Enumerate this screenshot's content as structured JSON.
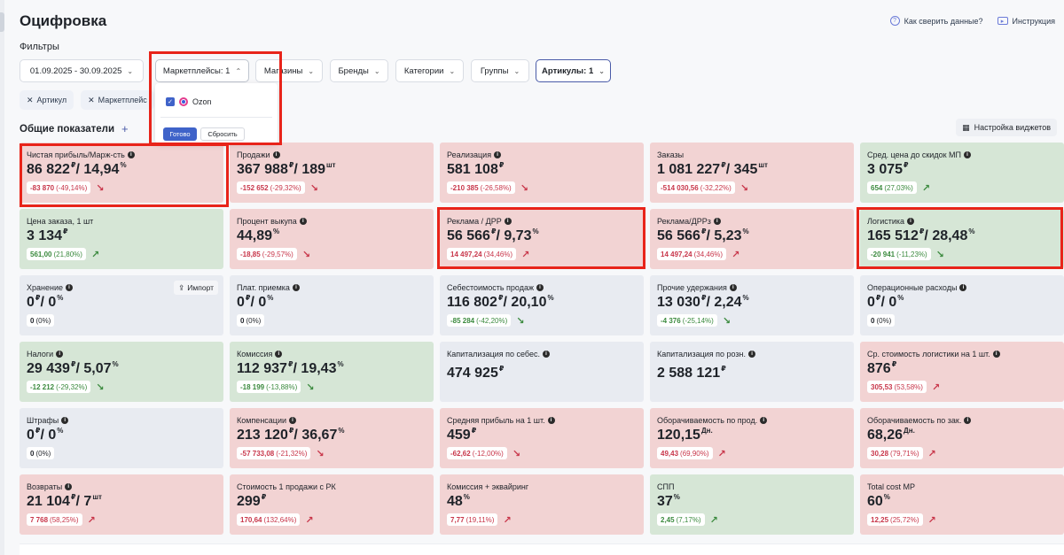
{
  "header": {
    "title": "Оцифровка",
    "link_compare": "Как сверить данные?",
    "link_instructions": "Инструкция"
  },
  "filters": {
    "label": "Фильтры",
    "date_range": "01.09.2025 - 30.09.2025",
    "marketplaces": "Маркетплейсы: 1",
    "stores": "Магазины",
    "brands": "Бренды",
    "categories": "Категории",
    "groups": "Группы",
    "articles": "Артикулы: 1"
  },
  "chips": [
    "Артикул",
    "Маркетплейс"
  ],
  "dropdown": {
    "option": "Ozon",
    "ok": "Готово",
    "reset": "Сбросить"
  },
  "section": {
    "title": "Общие показатели",
    "widget_settings": "Настройка виджетов",
    "import": "Импорт"
  },
  "cards": [
    {
      "label": "Чистая прибыль/Марж-сть",
      "value": "86 822",
      "u1": "₽",
      "value2": "/ 14,94",
      "u2": "%",
      "delta": "-83 870",
      "pct": "(-49,14%)",
      "trend": "neg",
      "bg": "red",
      "info": true
    },
    {
      "label": "Продажи",
      "value": "367 988",
      "u1": "₽",
      "value2": "/ 189",
      "u2": "шт",
      "delta": "-152 652",
      "pct": "(-29,32%)",
      "trend": "neg",
      "bg": "red",
      "info": true
    },
    {
      "label": "Реализация",
      "value": "581 108",
      "u1": "₽",
      "value2": "",
      "u2": "",
      "delta": "-210 385",
      "pct": "(-26,58%)",
      "trend": "neg",
      "bg": "red",
      "info": true
    },
    {
      "label": "Заказы",
      "value": "1 081 227",
      "u1": "₽",
      "value2": "/ 345",
      "u2": "шт",
      "delta": "-514 030,56",
      "pct": "(-32,22%)",
      "trend": "neg",
      "bg": "red",
      "info": false
    },
    {
      "label": "Сред. цена до скидок МП",
      "value": "3 075",
      "u1": "₽",
      "value2": "",
      "u2": "",
      "delta": "654",
      "pct": "(27,03%)",
      "trend": "pos",
      "bg": "green",
      "info": true
    },
    {
      "label": "Цена заказа, 1 шт",
      "value": "3 134",
      "u1": "₽",
      "value2": "",
      "u2": "",
      "delta": "561,00",
      "pct": "(21,80%)",
      "trend": "pos",
      "bg": "green",
      "info": false
    },
    {
      "label": "Процент выкупа",
      "value": "44,89",
      "u1": "%",
      "value2": "",
      "u2": "",
      "delta": "-18,85",
      "pct": "(-29,57%)",
      "trend": "neg",
      "bg": "red",
      "info": true
    },
    {
      "label": "Реклама / ДРР",
      "value": "56 566",
      "u1": "₽",
      "value2": "/ 9,73",
      "u2": "%",
      "delta": "14 497,24",
      "pct": "(34,46%)",
      "trend": "negup",
      "bg": "red",
      "info": true
    },
    {
      "label": "Реклама/ДРРз",
      "value": "56 566",
      "u1": "₽",
      "value2": "/ 5,23",
      "u2": "%",
      "delta": "14 497,24",
      "pct": "(34,46%)",
      "trend": "negup",
      "bg": "red",
      "info": true
    },
    {
      "label": "Логистика",
      "value": "165 512",
      "u1": "₽",
      "value2": "/ 28,48",
      "u2": "%",
      "delta": "-20 941",
      "pct": "(-11,23%)",
      "trend": "posdown",
      "bg": "green",
      "info": true
    },
    {
      "label": "Хранение",
      "value": "0",
      "u1": "₽",
      "value2": "/ 0",
      "u2": "%",
      "delta": "0",
      "pct": "(0%)",
      "trend": "none",
      "bg": "gray",
      "info": true,
      "import": true
    },
    {
      "label": "Плат. приемка",
      "value": "0",
      "u1": "₽",
      "value2": "/ 0",
      "u2": "%",
      "delta": "0",
      "pct": "(0%)",
      "trend": "none",
      "bg": "gray",
      "info": true
    },
    {
      "label": "Себестоимость продаж",
      "value": "116 802",
      "u1": "₽",
      "value2": "/ 20,10",
      "u2": "%",
      "delta": "-85 284",
      "pct": "(-42,20%)",
      "trend": "posdown",
      "bg": "gray",
      "info": true
    },
    {
      "label": "Прочие удержания",
      "value": "13 030",
      "u1": "₽",
      "value2": "/ 2,24",
      "u2": "%",
      "delta": "-4 376",
      "pct": "(-25,14%)",
      "trend": "posdown",
      "bg": "gray",
      "info": true
    },
    {
      "label": "Операционные расходы",
      "value": "0",
      "u1": "₽",
      "value2": "/ 0",
      "u2": "%",
      "delta": "0",
      "pct": "(0%)",
      "trend": "none",
      "bg": "gray",
      "info": true
    },
    {
      "label": "Налоги",
      "value": "29 439",
      "u1": "₽",
      "value2": "/ 5,07",
      "u2": "%",
      "delta": "-12 212",
      "pct": "(-29,32%)",
      "trend": "posdown",
      "bg": "green",
      "info": true
    },
    {
      "label": "Комиссия",
      "value": "112 937",
      "u1": "₽",
      "value2": "/ 19,43",
      "u2": "%",
      "delta": "-18 199",
      "pct": "(-13,88%)",
      "trend": "posdown",
      "bg": "green",
      "info": true
    },
    {
      "label": "Капитализация по себес.",
      "value": "474 925",
      "u1": "₽",
      "value2": "",
      "u2": "",
      "delta": "",
      "pct": "",
      "trend": "nodelta",
      "bg": "gray",
      "info": true
    },
    {
      "label": "Капитализация по розн.",
      "value": "2 588 121",
      "u1": "₽",
      "value2": "",
      "u2": "",
      "delta": "",
      "pct": "",
      "trend": "nodelta",
      "bg": "gray",
      "info": true
    },
    {
      "label": "Ср. стоимость логистики на 1 шт.",
      "value": "876",
      "u1": "₽",
      "value2": "",
      "u2": "",
      "delta": "305,53",
      "pct": "(53,58%)",
      "trend": "negup",
      "bg": "red",
      "info": true
    },
    {
      "label": "Штрафы",
      "value": "0",
      "u1": "₽",
      "value2": "/ 0",
      "u2": "%",
      "delta": "0",
      "pct": "(0%)",
      "trend": "none",
      "bg": "gray",
      "info": true
    },
    {
      "label": "Компенсации",
      "value": "213 120",
      "u1": "₽",
      "value2": "/ 36,67",
      "u2": "%",
      "delta": "-57 733,08",
      "pct": "(-21,32%)",
      "trend": "neg",
      "bg": "red",
      "info": true
    },
    {
      "label": "Средняя прибыль на 1 шт.",
      "value": "459",
      "u1": "₽",
      "value2": "",
      "u2": "",
      "delta": "-62,62",
      "pct": "(-12,00%)",
      "trend": "neg",
      "bg": "red",
      "info": true
    },
    {
      "label": "Оборачиваемость по прод.",
      "value": "120,15",
      "u1": "Дн.",
      "value2": "",
      "u2": "",
      "delta": "49,43",
      "pct": "(69,90%)",
      "trend": "negup",
      "bg": "red",
      "info": true
    },
    {
      "label": "Оборачиваемость по зак.",
      "value": "68,26",
      "u1": "Дн.",
      "value2": "",
      "u2": "",
      "delta": "30,28",
      "pct": "(79,71%)",
      "trend": "negup",
      "bg": "red",
      "info": true
    },
    {
      "label": "Возвраты",
      "value": "21 104",
      "u1": "₽",
      "value2": "/ 7",
      "u2": "шт",
      "delta": "7 768",
      "pct": "(58,25%)",
      "trend": "negup",
      "bg": "red",
      "info": true
    },
    {
      "label": "Стоимость 1 продажи с РК",
      "value": "299",
      "u1": "₽",
      "value2": "",
      "u2": "",
      "delta": "170,64",
      "pct": "(132,64%)",
      "trend": "negup",
      "bg": "red",
      "info": false
    },
    {
      "label": "Комиссия + эквайринг",
      "value": "48",
      "u1": "%",
      "value2": "",
      "u2": "",
      "delta": "7,77",
      "pct": "(19,11%)",
      "trend": "negup",
      "bg": "red",
      "info": false
    },
    {
      "label": "СПП",
      "value": "37",
      "u1": "%",
      "value2": "",
      "u2": "",
      "delta": "2,45",
      "pct": "(7,17%)",
      "trend": "posup",
      "bg": "green",
      "info": false
    },
    {
      "label": "Total cost MP",
      "value": "60",
      "u1": "%",
      "value2": "",
      "u2": "",
      "delta": "12,25",
      "pct": "(25,72%)",
      "trend": "negup",
      "bg": "red",
      "info": false
    }
  ]
}
